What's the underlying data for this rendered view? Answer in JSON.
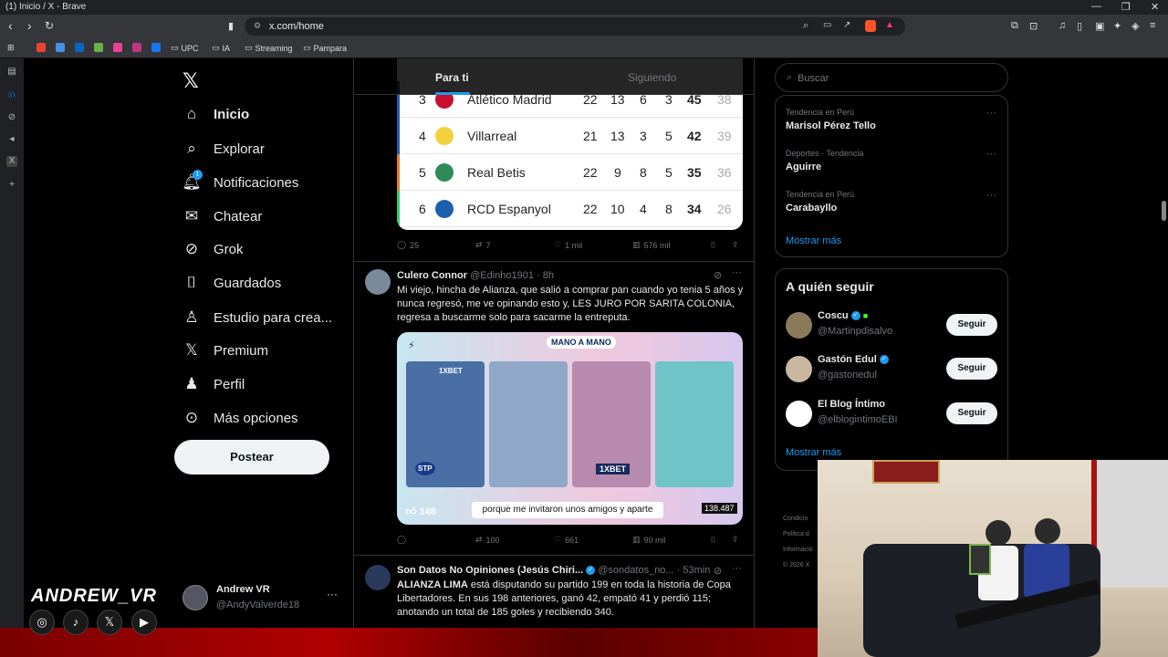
{
  "browser": {
    "tab_title": "(1) Inicio / X - Brave",
    "url": "x.com/home",
    "bookmarks": [
      "UPC",
      "IA",
      "Streaming",
      "Pampara"
    ]
  },
  "nav": {
    "items": [
      {
        "label": "Inicio",
        "icon": "home-icon"
      },
      {
        "label": "Explorar",
        "icon": "search-icon"
      },
      {
        "label": "Notificaciones",
        "icon": "bell-icon",
        "badge": "1"
      },
      {
        "label": "Chatear",
        "icon": "mail-icon"
      },
      {
        "label": "Grok",
        "icon": "grok-icon"
      },
      {
        "label": "Guardados",
        "icon": "bookmark-icon"
      },
      {
        "label": "Estudio para crea...",
        "icon": "studio-icon"
      },
      {
        "label": "Premium",
        "icon": "x-icon"
      },
      {
        "label": "Perfil",
        "icon": "person-icon"
      },
      {
        "label": "Más opciones",
        "icon": "more-icon"
      }
    ],
    "post_label": "Postear",
    "account": {
      "name": "Andrew VR",
      "handle": "@AndyValverde18"
    }
  },
  "feed": {
    "tabs": [
      "Para ti",
      "Siguiendo"
    ],
    "standings": [
      {
        "pos": "3",
        "team": "Atlético Madrid",
        "pj": "22",
        "g": "13",
        "e": "6",
        "p": "3",
        "pts": "45",
        "extra": "38",
        "color": "#1a5fb4"
      },
      {
        "pos": "4",
        "team": "Villarreal",
        "pj": "21",
        "g": "13",
        "e": "3",
        "p": "5",
        "pts": "42",
        "extra": "39",
        "color": "#1a5fb4"
      },
      {
        "pos": "5",
        "team": "Real Betis",
        "pj": "22",
        "g": "9",
        "e": "8",
        "p": "5",
        "pts": "35",
        "extra": "36",
        "color": "#e67e22"
      },
      {
        "pos": "6",
        "team": "RCD Espanyol",
        "pj": "22",
        "g": "10",
        "e": "4",
        "p": "8",
        "pts": "34",
        "extra": "26",
        "color": "#2ecc71"
      }
    ],
    "tweet1_actions": {
      "replies": "25",
      "reposts": "7",
      "likes": "1 mil",
      "views": "576 mil"
    },
    "tweet2": {
      "name": "Culero Connor",
      "handle": "@Edinho1901 · 8h",
      "text": "Mi viejo, hincha de Alianza, que salió a comprar pan cuando yo tenia 5 años y nunca regresó, me ve opinando esto y, LES JURO POR SARITA COLONIA, regresa a buscarme solo para sacarme la entreputa.",
      "media": {
        "likes": "148",
        "caption": "porque me invitaron unos amigos y aparte",
        "count": "138.487",
        "brand": "1XBET",
        "logo": "MANO A MANO",
        "stp": "STP"
      },
      "actions": {
        "replies": "",
        "reposts": "100",
        "likes": "661",
        "views": "90 mil"
      }
    },
    "tweet3": {
      "name": "Son Datos No Opiniones (Jesús Chiri...",
      "handle": "@sondatos_no... · 53min",
      "text_bold": "ALIANZA LIMA",
      "text": " está disputando su partido 199 en toda la historia de Copa Libertadores. En sus 198 anteriores, ganó 42, empató 41 y perdió 115; anotando un total de 185 goles y recibiendo 340."
    }
  },
  "right": {
    "search_placeholder": "Buscar",
    "trends": [
      {
        "meta": "Tendencia en Perú",
        "name": "Marisol Pérez Tello"
      },
      {
        "meta": "Deportes · Tendencia",
        "name": "Aguirre"
      },
      {
        "meta": "Tendencia en Perú",
        "name": "Carabayllo"
      }
    ],
    "show_more": "Mostrar más",
    "who_title": "A quién seguir",
    "who": [
      {
        "name": "Coscu",
        "handle": "@Martinpdisalvo",
        "avatar_color": "#8a7a5a"
      },
      {
        "name": "Gastón Edul",
        "handle": "@gastonedul",
        "avatar_color": "#c9b7a0"
      },
      {
        "name": "El Blog Íntimo",
        "handle": "@elblogintimoEBI",
        "avatar_color": "#ffffff"
      }
    ],
    "follow_label": "Seguir",
    "footer": [
      "Condicio",
      "Política d",
      "Informació",
      "© 2026 X"
    ]
  },
  "overlay": {
    "streamer": "ANDREW_VR",
    "socials": [
      "instagram-icon",
      "tiktok-icon",
      "x-icon",
      "youtube-icon"
    ]
  }
}
